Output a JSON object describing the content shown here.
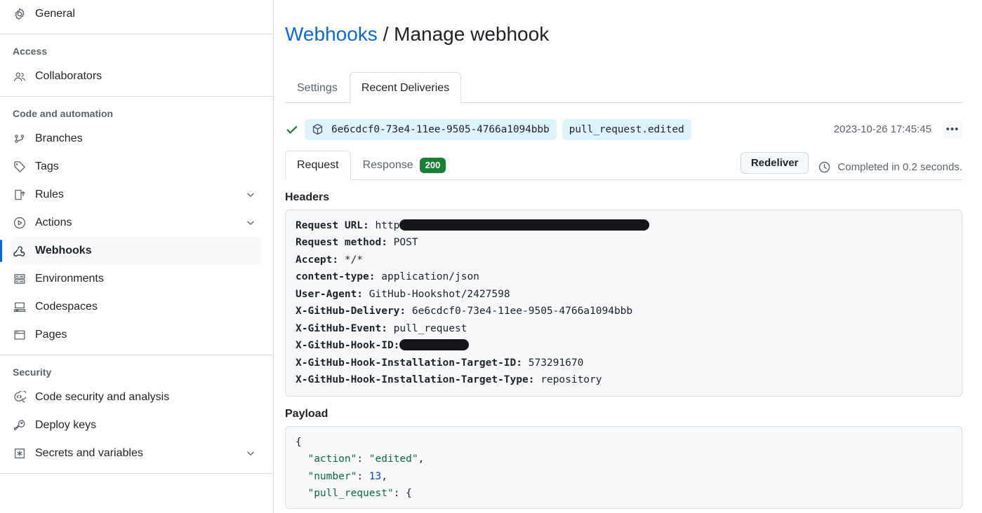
{
  "sidebar": {
    "top_items": [
      {
        "label": "General",
        "icon": "gear-icon",
        "selected": false,
        "expandable": false
      }
    ],
    "groups": [
      {
        "label": "Access",
        "items": [
          {
            "label": "Collaborators",
            "icon": "people-icon",
            "selected": false,
            "expandable": false
          }
        ]
      },
      {
        "label": "Code and automation",
        "items": [
          {
            "label": "Branches",
            "icon": "branch-icon",
            "selected": false,
            "expandable": false
          },
          {
            "label": "Tags",
            "icon": "tag-icon",
            "selected": false,
            "expandable": false
          },
          {
            "label": "Rules",
            "icon": "rules-icon",
            "selected": false,
            "expandable": true
          },
          {
            "label": "Actions",
            "icon": "play-icon",
            "selected": false,
            "expandable": true
          },
          {
            "label": "Webhooks",
            "icon": "webhook-icon",
            "selected": true,
            "expandable": false
          },
          {
            "label": "Environments",
            "icon": "server-icon",
            "selected": false,
            "expandable": false
          },
          {
            "label": "Codespaces",
            "icon": "codespaces-icon",
            "selected": false,
            "expandable": false
          },
          {
            "label": "Pages",
            "icon": "browser-icon",
            "selected": false,
            "expandable": false
          }
        ]
      },
      {
        "label": "Security",
        "items": [
          {
            "label": "Code security and analysis",
            "icon": "code-shield-icon",
            "selected": false,
            "expandable": false
          },
          {
            "label": "Deploy keys",
            "icon": "key-icon",
            "selected": false,
            "expandable": false
          },
          {
            "label": "Secrets and variables",
            "icon": "asterisk-icon",
            "selected": false,
            "expandable": true
          }
        ]
      }
    ]
  },
  "header": {
    "breadcrumb_link": "Webhooks",
    "breadcrumb_separator": "/",
    "breadcrumb_current": "Manage webhook"
  },
  "tabs": [
    {
      "label": "Settings",
      "active": false
    },
    {
      "label": "Recent Deliveries",
      "active": true
    }
  ],
  "delivery": {
    "status_icon": "check-icon",
    "package_icon": "package-icon",
    "guid": "6e6cdcf0-73e4-11ee-9505-4766a1094bbb",
    "event": "pull_request.edited",
    "timestamp": "2023-10-26 17:45:45",
    "kebab_label": "•••"
  },
  "inner_tabs": [
    {
      "label": "Request",
      "active": true,
      "badge": null
    },
    {
      "label": "Response",
      "active": false,
      "badge": "200"
    }
  ],
  "actions": {
    "redeliver_label": "Redeliver",
    "clock_icon": "clock-icon",
    "completed_text": "Completed in 0.2 seconds."
  },
  "headers_section": {
    "title": "Headers",
    "rows": [
      {
        "key": "Request URL:",
        "value": "http",
        "redacted": true,
        "redact_width": 356
      },
      {
        "key": "Request method:",
        "value": "POST",
        "redacted": false
      },
      {
        "key": "Accept:",
        "value": "*/*",
        "redacted": false
      },
      {
        "key": "content-type:",
        "value": "application/json",
        "redacted": false
      },
      {
        "key": "User-Agent:",
        "value": "GitHub-Hookshot/2427598",
        "redacted": false
      },
      {
        "key": "X-GitHub-Delivery:",
        "value": "6e6cdcf0-73e4-11ee-9505-4766a1094bbb",
        "redacted": false
      },
      {
        "key": "X-GitHub-Event:",
        "value": "pull_request",
        "redacted": false
      },
      {
        "key": "X-GitHub-Hook-ID:",
        "value": "",
        "redacted": true,
        "redact_width": 99,
        "no_space": true
      },
      {
        "key": "X-GitHub-Hook-Installation-Target-ID:",
        "value": "573291670",
        "redacted": false
      },
      {
        "key": "X-GitHub-Hook-Installation-Target-Type:",
        "value": "repository",
        "redacted": false
      }
    ]
  },
  "payload_section": {
    "title": "Payload",
    "lines": [
      {
        "indent": 0,
        "tokens": [
          {
            "t": "{",
            "c": "pun"
          }
        ]
      },
      {
        "indent": 1,
        "tokens": [
          {
            "t": "\"action\"",
            "c": "key"
          },
          {
            "t": ": ",
            "c": "pun"
          },
          {
            "t": "\"edited\"",
            "c": "str"
          },
          {
            "t": ",",
            "c": "pun"
          }
        ]
      },
      {
        "indent": 1,
        "tokens": [
          {
            "t": "\"number\"",
            "c": "key"
          },
          {
            "t": ": ",
            "c": "pun"
          },
          {
            "t": "13",
            "c": "num"
          },
          {
            "t": ",",
            "c": "pun"
          }
        ]
      },
      {
        "indent": 1,
        "tokens": [
          {
            "t": "\"pull_request\"",
            "c": "key"
          },
          {
            "t": ": {",
            "c": "pun"
          }
        ]
      }
    ]
  },
  "colors": {
    "accent": "#0969da",
    "success": "#1a7f37",
    "chip_bg": "#ddf4ff",
    "muted": "#59636e",
    "border": "#d8dee4",
    "code_bg": "#f6f8fa"
  }
}
